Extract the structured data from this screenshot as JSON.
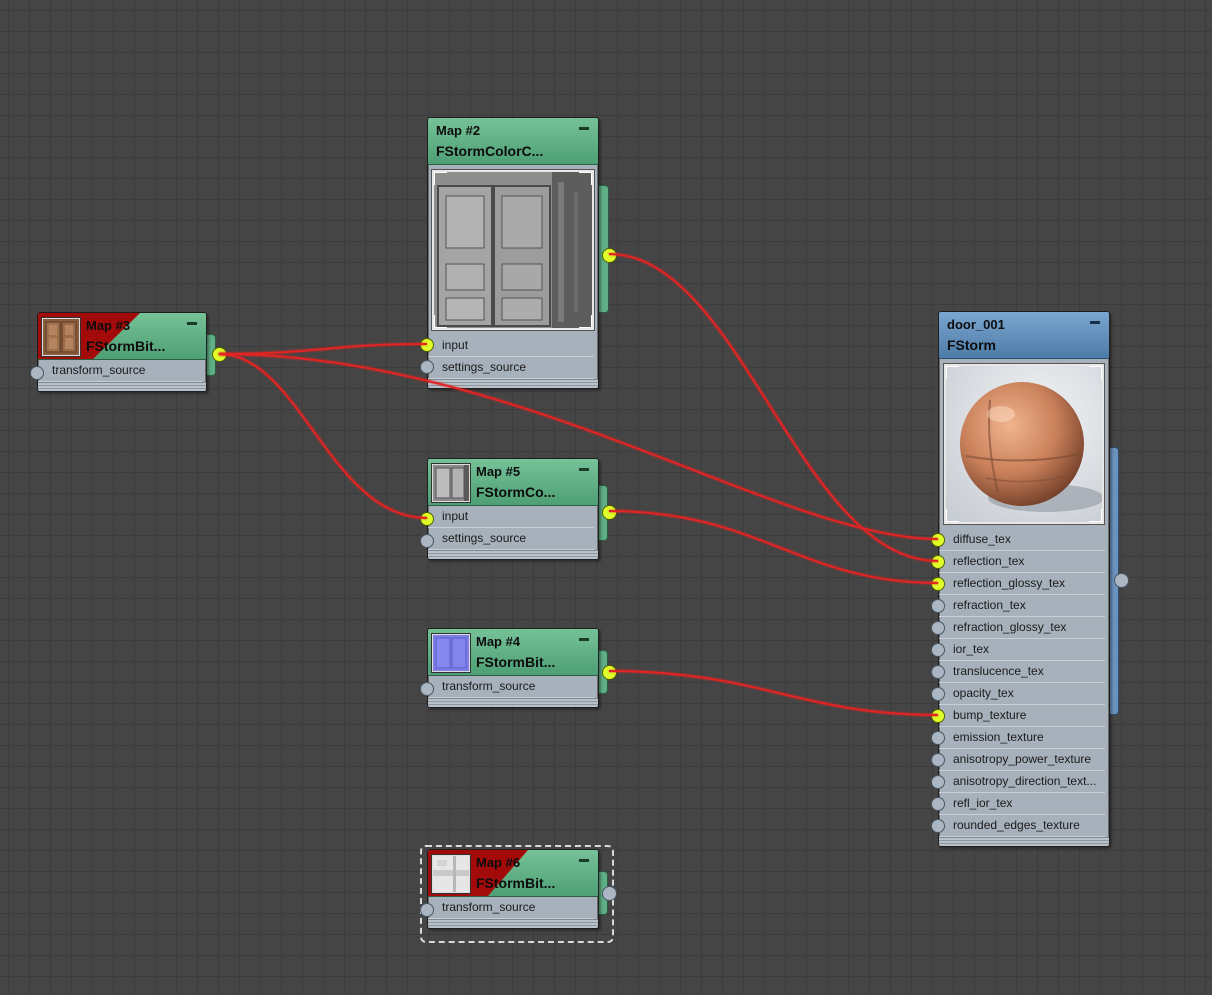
{
  "nodes": {
    "map3": {
      "title": "Map #3",
      "type": "FStormBit...",
      "slots": [
        "transform_source"
      ]
    },
    "map2": {
      "title": "Map #2",
      "type": "FStormColorC...",
      "slots": [
        "input",
        "settings_source"
      ]
    },
    "map5": {
      "title": "Map #5",
      "type": "FStormCo...",
      "slots": [
        "input",
        "settings_source"
      ]
    },
    "map4": {
      "title": "Map #4",
      "type": "FStormBit...",
      "slots": [
        "transform_source"
      ]
    },
    "map6": {
      "title": "Map #6",
      "type": "FStormBit...",
      "slots": [
        "transform_source"
      ]
    },
    "door": {
      "title": "door_001",
      "type": "FStorm",
      "slots": [
        "diffuse_tex",
        "reflection_tex",
        "reflection_glossy_tex",
        "refraction_tex",
        "refraction_glossy_tex",
        "ior_tex",
        "translucence_tex",
        "opacity_tex",
        "bump_texture",
        "emission_texture",
        "anisotropy_power_texture",
        "anisotropy_direction_text...",
        "refl_ior_tex",
        "rounded_edges_texture"
      ]
    }
  },
  "colors": {
    "wire": "#e02424",
    "socket_connected": "#e0ff2a",
    "socket_empty": "#aab6c3",
    "map_header": "#5fae85",
    "material_header": "#6a93bd"
  },
  "connections": [
    {
      "from": "map3",
      "to": "map2.input"
    },
    {
      "from": "map3",
      "to": "map5.input"
    },
    {
      "from": "map3",
      "to": "door.diffuse_tex"
    },
    {
      "from": "map2",
      "to": "door.reflection_tex"
    },
    {
      "from": "map5",
      "to": "door.reflection_glossy_tex"
    },
    {
      "from": "map4",
      "to": "door.bump_texture"
    }
  ]
}
